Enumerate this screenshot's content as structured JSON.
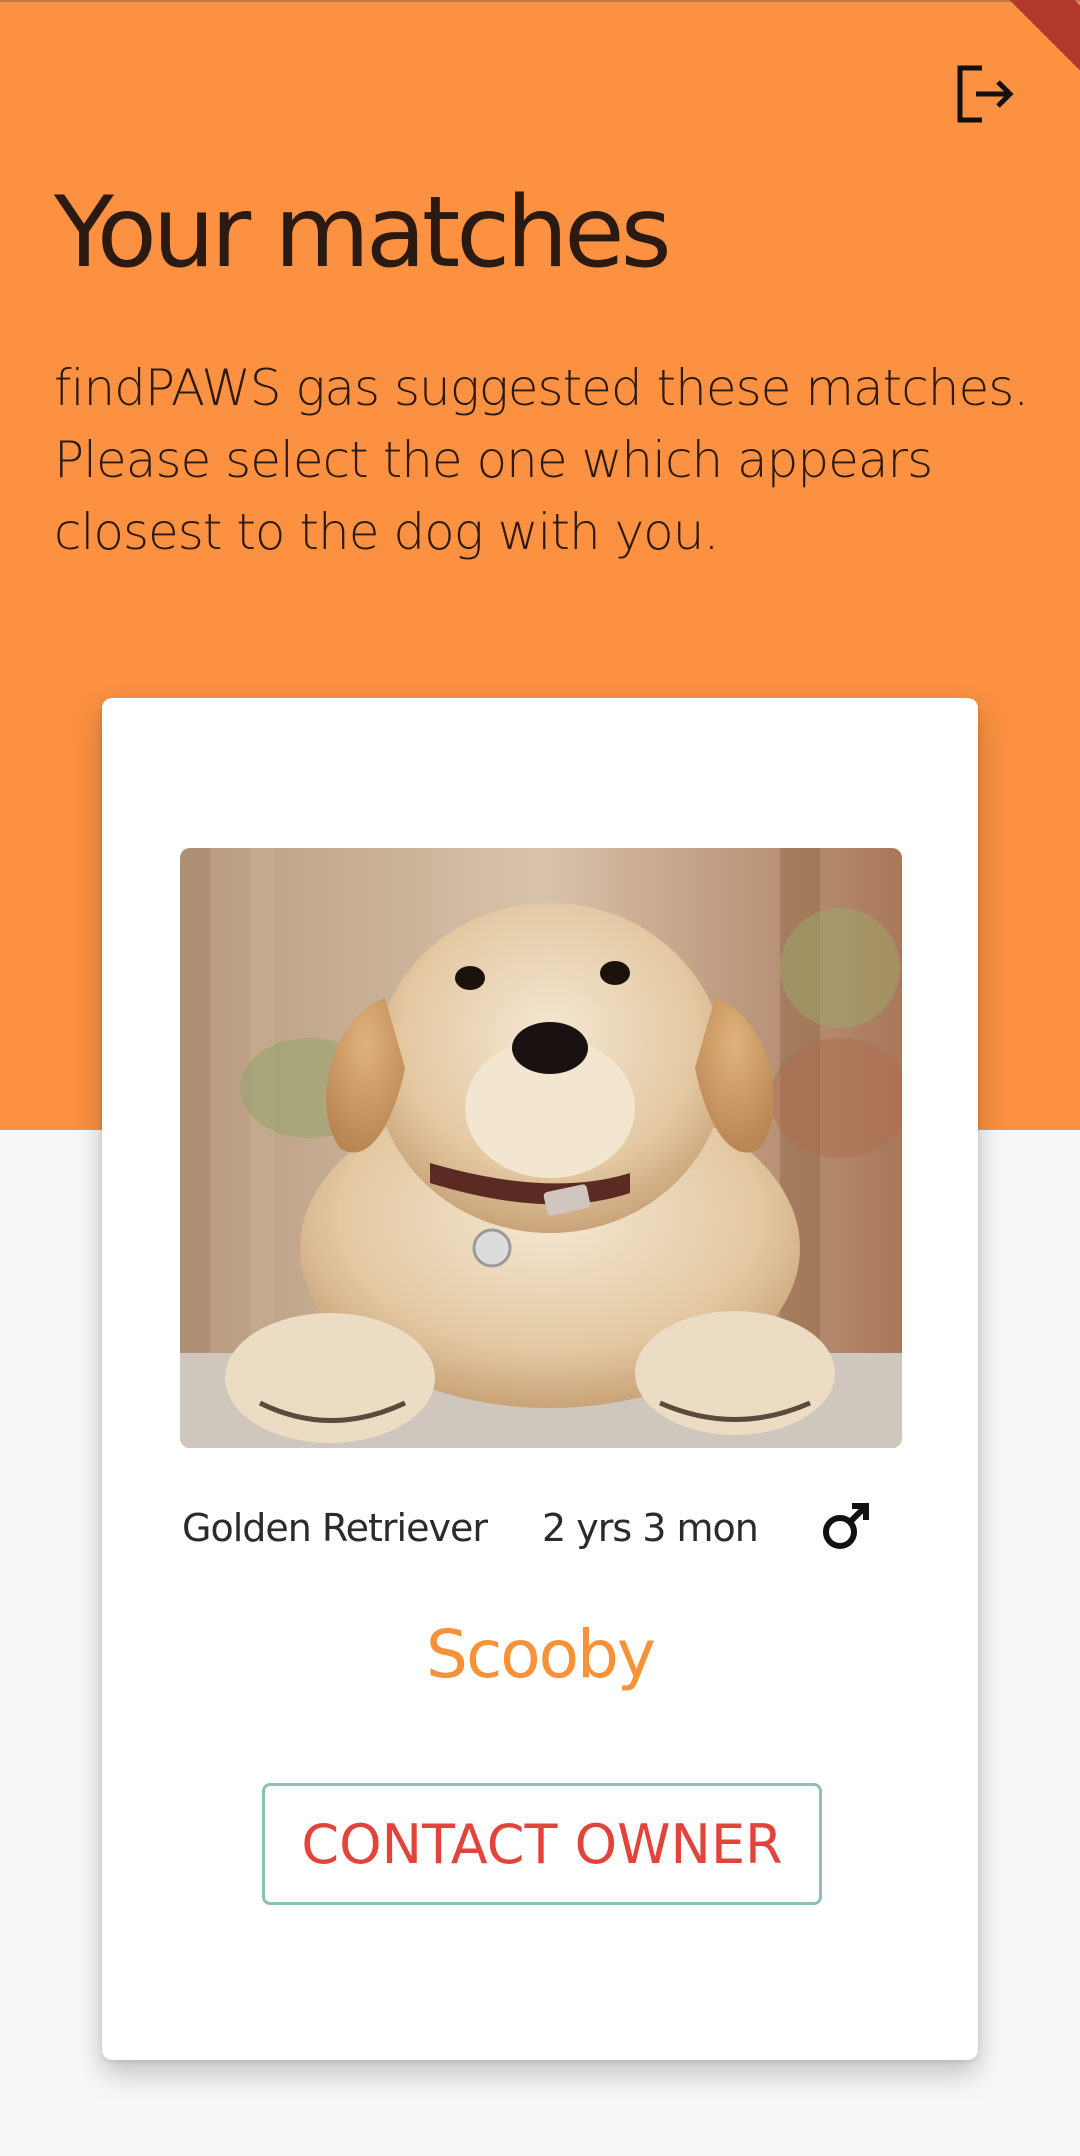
{
  "header": {
    "title": "Your matches",
    "description": "findPAWS gas suggested these matches. Please select the one which appears closest to the dog with you."
  },
  "icons": {
    "logout": "logout-icon",
    "gender": "male-icon"
  },
  "colors": {
    "hero_bg": "#fb9141",
    "accent_name": "#f79238",
    "button_text": "#e2443b",
    "button_border": "#8cc2b6"
  },
  "match": {
    "breed": "Golden Retriever",
    "age": "2 yrs  3 mon",
    "gender": "male",
    "name": "Scooby",
    "contact_label": "CONTACT OWNER"
  }
}
